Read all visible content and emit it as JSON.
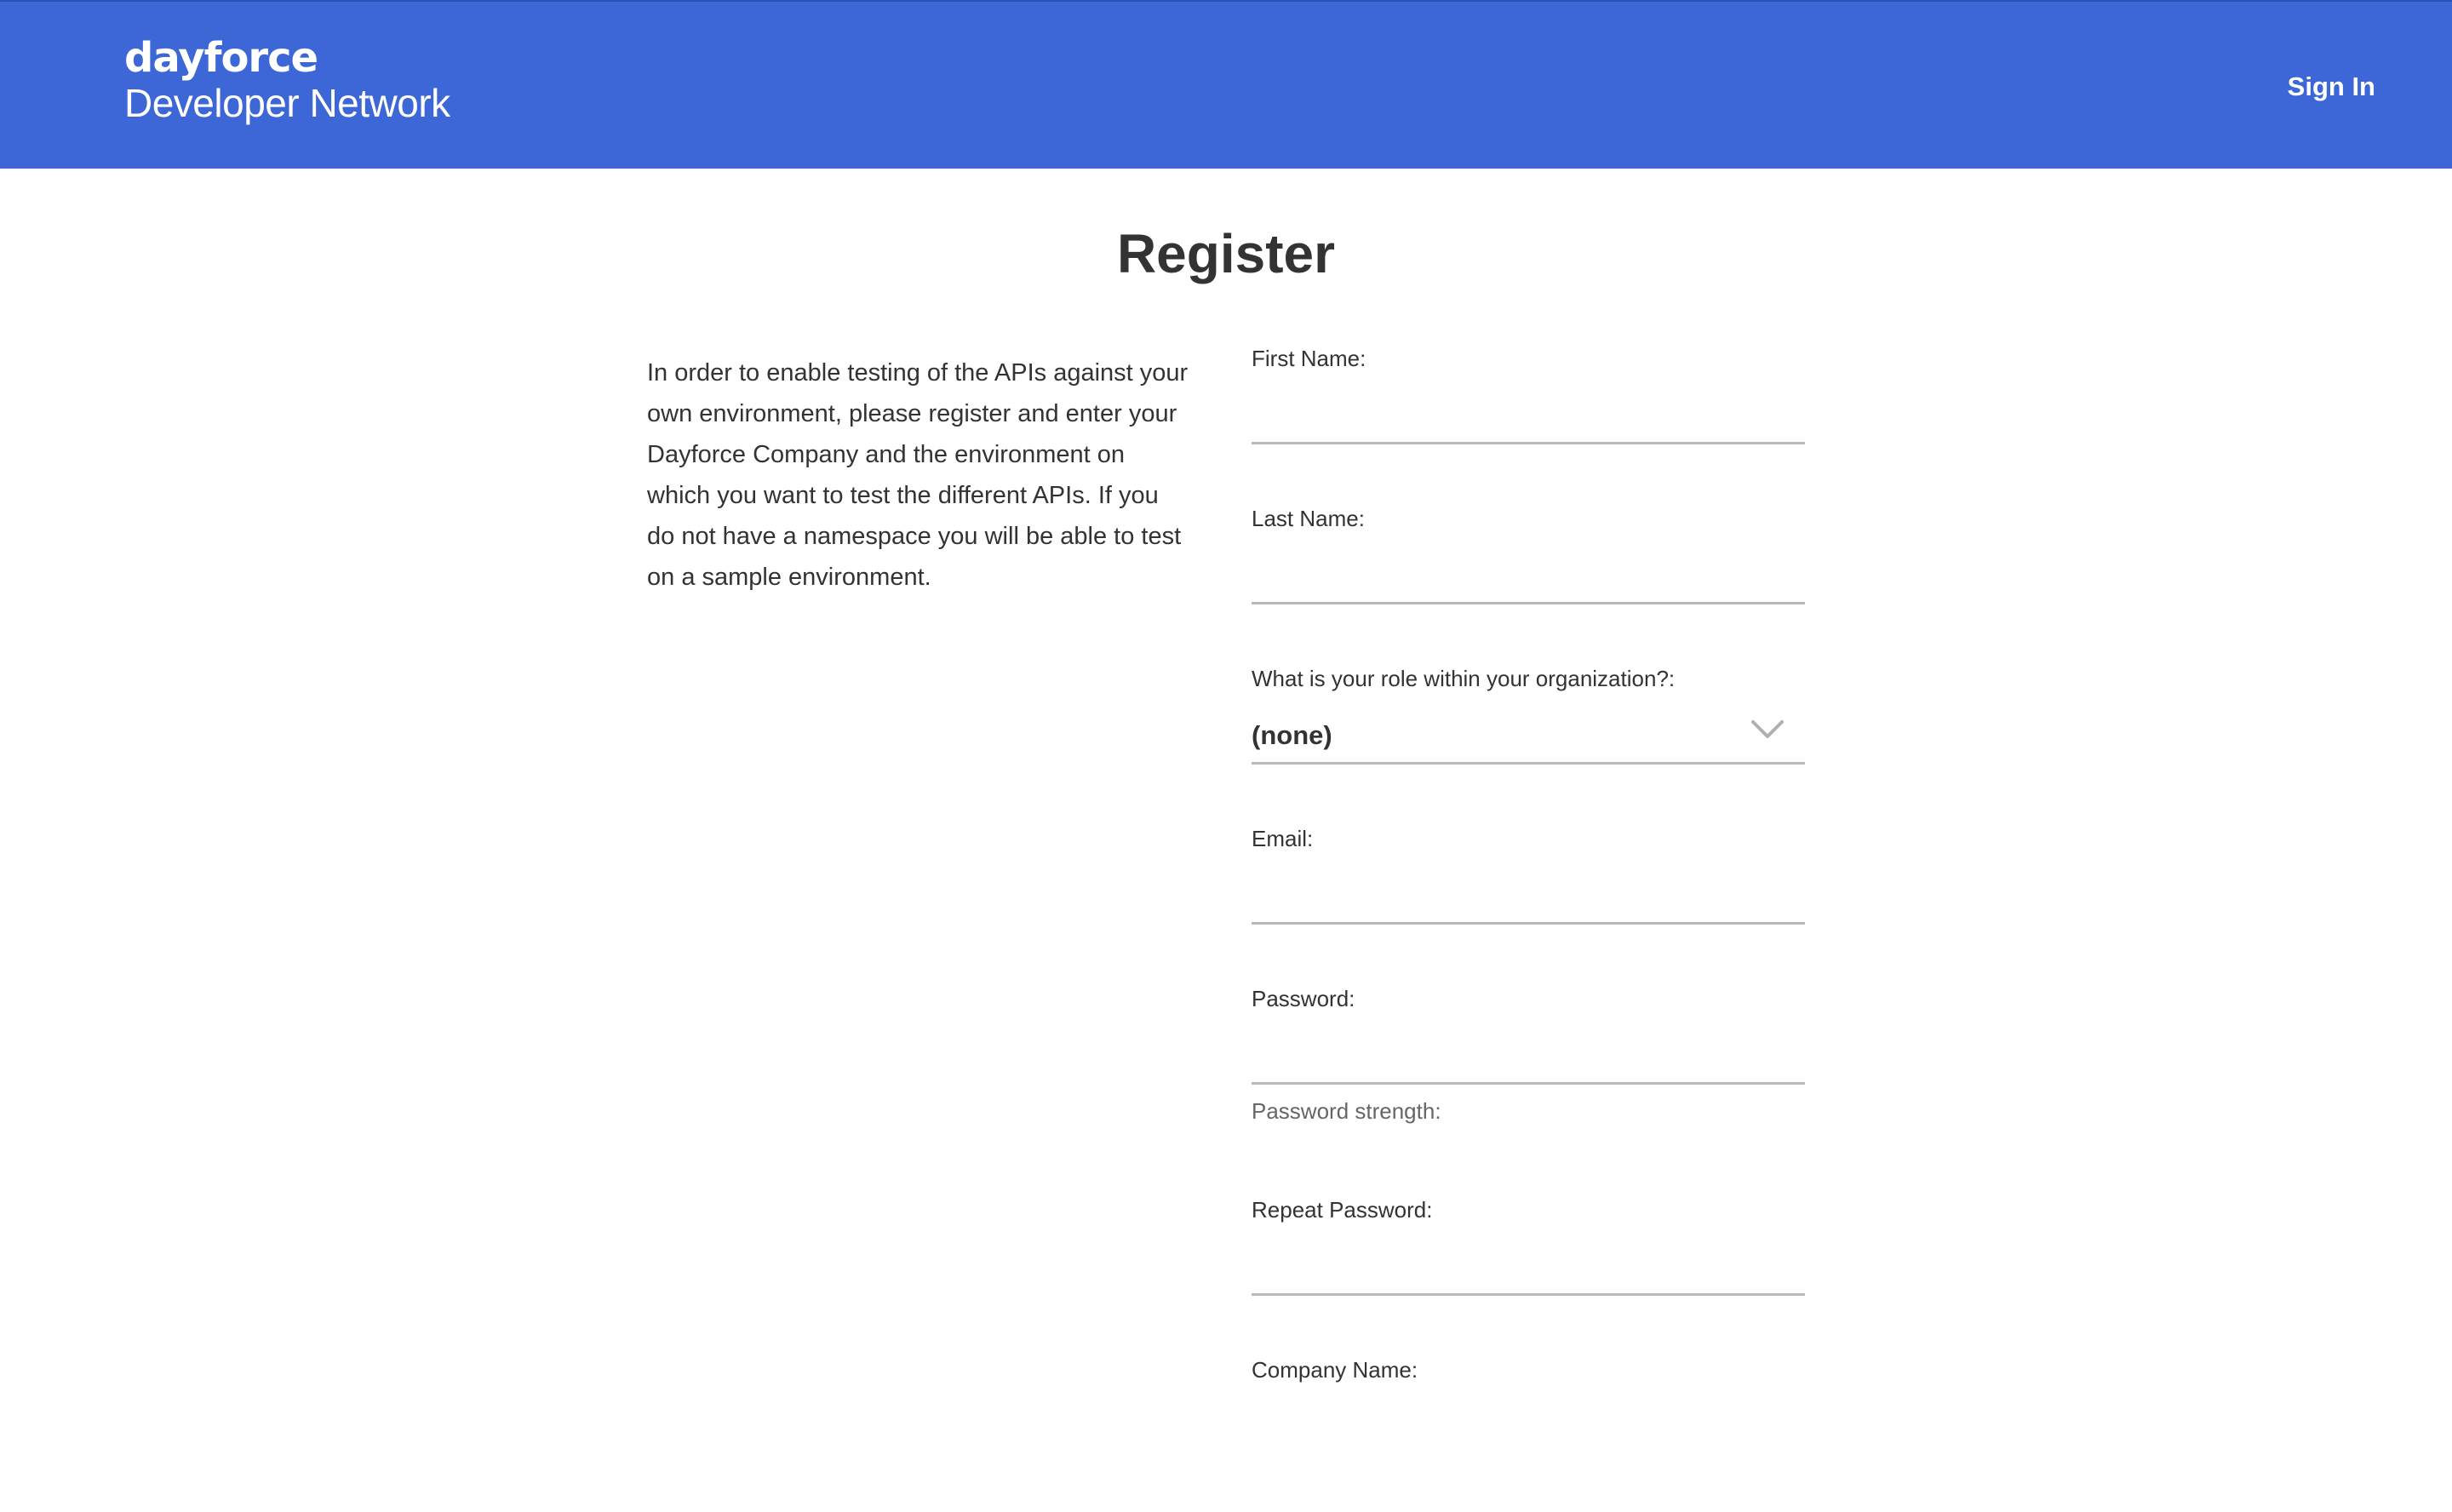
{
  "header": {
    "logo_top": "dayforce",
    "logo_bottom": "Developer Network",
    "sign_in": "Sign In",
    "background_color": "#3d67d7"
  },
  "page": {
    "title": "Register",
    "intro": "In order to enable testing of the APIs against your own environment, please register and enter your Dayforce Company and the environment on which you want to test the different APIs. If you do not have a namespace you will be able to test on a sample environment."
  },
  "form": {
    "first_name_label": "First Name:",
    "first_name_value": "",
    "last_name_label": "Last Name:",
    "last_name_value": "",
    "role_label": "What is your role within your organization?:",
    "role_value": "(none)",
    "email_label": "Email:",
    "email_value": "",
    "password_label": "Password:",
    "password_value": "",
    "password_strength_label": "Password strength:",
    "repeat_password_label": "Repeat Password:",
    "repeat_password_value": "",
    "company_name_label": "Company Name:"
  },
  "icons": {
    "role_dropdown": "chevron-down-icon"
  }
}
